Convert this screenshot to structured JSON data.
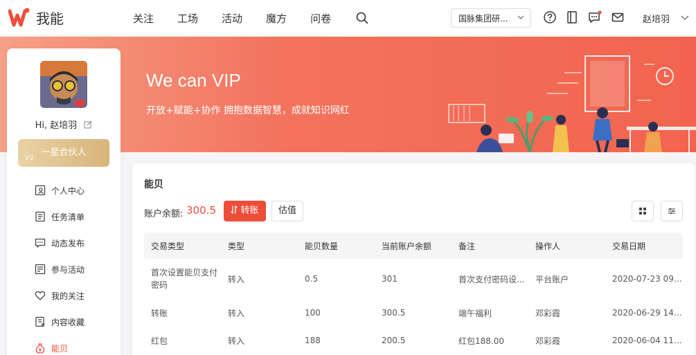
{
  "app": {
    "name": "我能"
  },
  "nav": {
    "items": [
      "关注",
      "工场",
      "活动",
      "魔方",
      "问卷"
    ]
  },
  "header": {
    "org": "国脉集团研...",
    "user": "赵培羽"
  },
  "banner": {
    "title": "We can VIP",
    "subtitle": "开放+赋能+协作   拥抱数据智慧，成就知识网红"
  },
  "sidebar": {
    "greeting": "Hi, 赵培羽",
    "badge": "V1",
    "partner": "一星合伙人",
    "items": [
      {
        "label": "个人中心",
        "icon": "profile-icon"
      },
      {
        "label": "任务清单",
        "icon": "task-list-icon"
      },
      {
        "label": "动态发布",
        "icon": "post-icon"
      },
      {
        "label": "参与活动",
        "icon": "activity-icon"
      },
      {
        "label": "我的关注",
        "icon": "heart-icon"
      },
      {
        "label": "内容收藏",
        "icon": "collection-icon"
      },
      {
        "label": "能贝",
        "icon": "coin-bag-icon"
      }
    ],
    "active": "能贝"
  },
  "main": {
    "title": "能贝",
    "balance_label": "账户余额:",
    "balance_value": "300.5",
    "transfer_label": "转账",
    "estimate_label": "估值"
  },
  "table": {
    "columns": [
      "交易类型",
      "类型",
      "能贝数量",
      "当前账户余额",
      "备注",
      "操作人",
      "交易日期"
    ],
    "rows": [
      [
        "首次设置能贝支付密码",
        "转入",
        "0.5",
        "301",
        "首次支付密码设...",
        "平台账户",
        "2020-07-23 09:..."
      ],
      [
        "转账",
        "转入",
        "100",
        "300.5",
        "端午福利",
        "邓彩霞",
        "2020-06-29 14:..."
      ],
      [
        "红包",
        "转入",
        "188",
        "200.5",
        "红包188.00",
        "邓彩霞",
        "2020-06-04 11:..."
      ]
    ]
  },
  "colors": {
    "accent": "#ee4d3a",
    "gold": "#d8b47a"
  }
}
